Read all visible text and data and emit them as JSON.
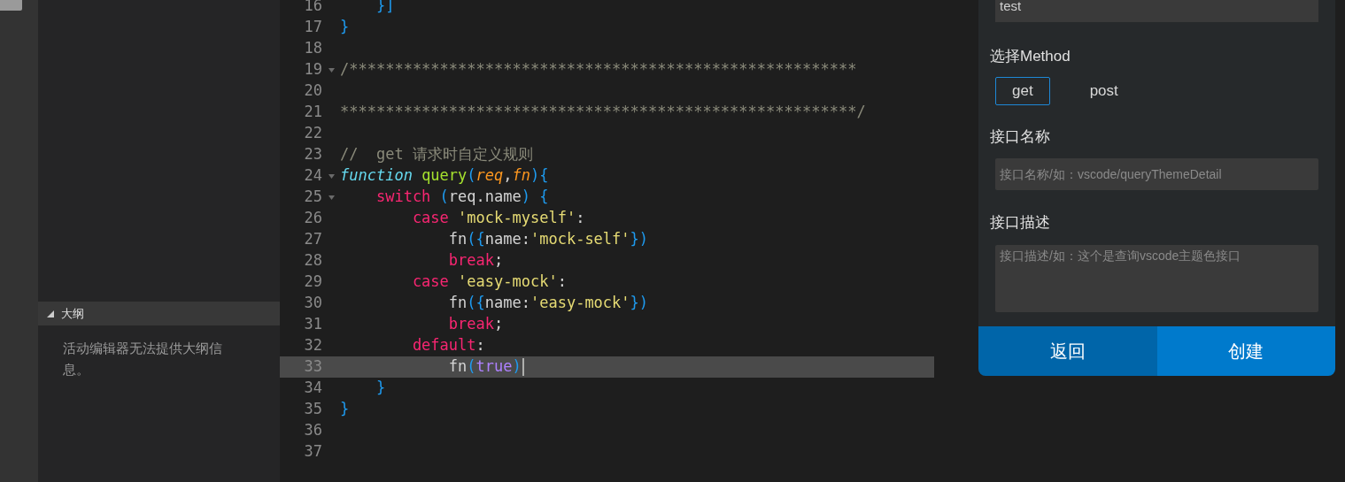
{
  "outline": {
    "title": "大纲",
    "expanded": true,
    "message": "活动编辑器无法提供大纲信息。"
  },
  "editor": {
    "lines": [
      {
        "number": "16",
        "fold": false,
        "current": false,
        "tokens": [
          {
            "kind": "bracket",
            "text": "    }]"
          }
        ]
      },
      {
        "number": "17",
        "fold": false,
        "current": false,
        "tokens": [
          {
            "kind": "bracket",
            "text": "}"
          }
        ]
      },
      {
        "number": "18",
        "fold": false,
        "current": false
      },
      {
        "number": "19",
        "fold": true,
        "current": false,
        "tokens": [
          {
            "kind": "comment",
            "text": "/********************************************************"
          }
        ]
      },
      {
        "number": "20",
        "fold": false,
        "current": false
      },
      {
        "number": "21",
        "fold": false,
        "current": false,
        "tokens": [
          {
            "kind": "comment",
            "text": "*********************************************************/"
          }
        ]
      },
      {
        "number": "22",
        "fold": false,
        "current": false
      },
      {
        "number": "23",
        "fold": false,
        "current": false,
        "tokens": [
          {
            "kind": "comment",
            "text": "//  get 请求时自定义规则"
          }
        ]
      },
      {
        "number": "24",
        "fold": true,
        "current": false,
        "tokens": [
          {
            "kind": "storage",
            "text": "function "
          },
          {
            "kind": "func",
            "text": "query"
          },
          {
            "kind": "bracket",
            "text": "("
          },
          {
            "kind": "param",
            "text": "req"
          },
          {
            "kind": "plain",
            "text": ","
          },
          {
            "kind": "param",
            "text": "fn"
          },
          {
            "kind": "bracket",
            "text": "){"
          }
        ]
      },
      {
        "number": "25",
        "fold": true,
        "current": false,
        "tokens": [
          {
            "kind": "keyword",
            "text": "    switch "
          },
          {
            "kind": "bracket",
            "text": "("
          },
          {
            "kind": "plain",
            "text": "req.name"
          },
          {
            "kind": "bracket",
            "text": ") {"
          }
        ]
      },
      {
        "number": "26",
        "fold": false,
        "current": false,
        "tokens": [
          {
            "kind": "keyword",
            "text": "        case "
          },
          {
            "kind": "string",
            "text": "'mock-myself'"
          },
          {
            "kind": "plain",
            "text": ":"
          }
        ]
      },
      {
        "number": "27",
        "fold": false,
        "current": false,
        "tokens": [
          {
            "kind": "plain",
            "text": "            fn"
          },
          {
            "kind": "bracket",
            "text": "({"
          },
          {
            "kind": "plain",
            "text": "name:"
          },
          {
            "kind": "string",
            "text": "'mock-self'"
          },
          {
            "kind": "bracket",
            "text": "})"
          }
        ]
      },
      {
        "number": "28",
        "fold": false,
        "current": false,
        "tokens": [
          {
            "kind": "keyword",
            "text": "            break"
          },
          {
            "kind": "plain",
            "text": ";"
          }
        ]
      },
      {
        "number": "29",
        "fold": false,
        "current": false,
        "tokens": [
          {
            "kind": "keyword",
            "text": "        case "
          },
          {
            "kind": "string",
            "text": "'easy-mock'"
          },
          {
            "kind": "plain",
            "text": ":"
          }
        ]
      },
      {
        "number": "30",
        "fold": false,
        "current": false,
        "tokens": [
          {
            "kind": "plain",
            "text": "            fn"
          },
          {
            "kind": "bracket",
            "text": "({"
          },
          {
            "kind": "plain",
            "text": "name:"
          },
          {
            "kind": "string",
            "text": "'easy-mock'"
          },
          {
            "kind": "bracket",
            "text": "})"
          }
        ]
      },
      {
        "number": "31",
        "fold": false,
        "current": false,
        "tokens": [
          {
            "kind": "keyword",
            "text": "            break"
          },
          {
            "kind": "plain",
            "text": ";"
          }
        ]
      },
      {
        "number": "32",
        "fold": false,
        "current": false,
        "tokens": [
          {
            "kind": "keyword",
            "text": "        default"
          },
          {
            "kind": "plain",
            "text": ":"
          }
        ]
      },
      {
        "number": "33",
        "fold": false,
        "current": true,
        "tokens": [
          {
            "kind": "plain",
            "text": "            fn"
          },
          {
            "kind": "bracket",
            "text": "("
          },
          {
            "kind": "constant",
            "text": "true"
          },
          {
            "kind": "bracket",
            "text": ")"
          }
        ]
      },
      {
        "number": "34",
        "fold": false,
        "current": false,
        "tokens": [
          {
            "kind": "bracket",
            "text": "    }"
          }
        ]
      },
      {
        "number": "35",
        "fold": false,
        "current": false,
        "tokens": [
          {
            "kind": "bracket",
            "text": "}"
          }
        ]
      },
      {
        "number": "36",
        "fold": false,
        "current": false
      },
      {
        "number": "37",
        "fold": false,
        "current": false
      }
    ]
  },
  "form": {
    "name_value": "test",
    "method_label": "选择Method",
    "methods": [
      {
        "label": "get",
        "selected": true
      },
      {
        "label": "post",
        "selected": false
      }
    ],
    "api_name_label": "接口名称",
    "api_name_placeholder": "接口名称/如：vscode/queryThemeDetail",
    "api_desc_label": "接口描述",
    "api_desc_placeholder": "接口描述/如：这个是查询vscode主题色接口",
    "buttons": [
      {
        "label": "返回",
        "kind": "secondary"
      },
      {
        "label": "创建",
        "kind": "primary"
      }
    ]
  }
}
